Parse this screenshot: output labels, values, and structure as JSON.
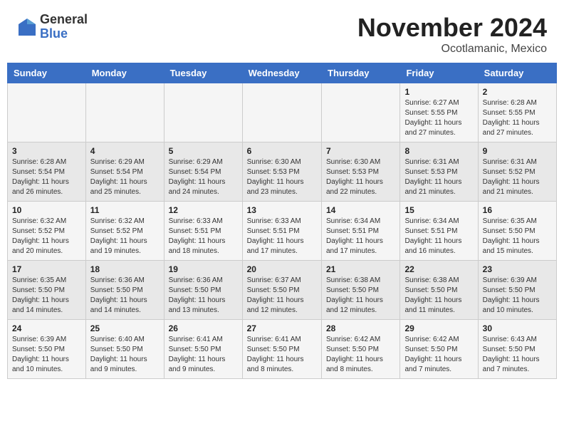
{
  "header": {
    "logo_general": "General",
    "logo_blue": "Blue",
    "month": "November 2024",
    "location": "Ocotlamanic, Mexico"
  },
  "weekdays": [
    "Sunday",
    "Monday",
    "Tuesday",
    "Wednesday",
    "Thursday",
    "Friday",
    "Saturday"
  ],
  "weeks": [
    [
      {
        "day": "",
        "info": ""
      },
      {
        "day": "",
        "info": ""
      },
      {
        "day": "",
        "info": ""
      },
      {
        "day": "",
        "info": ""
      },
      {
        "day": "",
        "info": ""
      },
      {
        "day": "1",
        "info": "Sunrise: 6:27 AM\nSunset: 5:55 PM\nDaylight: 11 hours\nand 27 minutes."
      },
      {
        "day": "2",
        "info": "Sunrise: 6:28 AM\nSunset: 5:55 PM\nDaylight: 11 hours\nand 27 minutes."
      }
    ],
    [
      {
        "day": "3",
        "info": "Sunrise: 6:28 AM\nSunset: 5:54 PM\nDaylight: 11 hours\nand 26 minutes."
      },
      {
        "day": "4",
        "info": "Sunrise: 6:29 AM\nSunset: 5:54 PM\nDaylight: 11 hours\nand 25 minutes."
      },
      {
        "day": "5",
        "info": "Sunrise: 6:29 AM\nSunset: 5:54 PM\nDaylight: 11 hours\nand 24 minutes."
      },
      {
        "day": "6",
        "info": "Sunrise: 6:30 AM\nSunset: 5:53 PM\nDaylight: 11 hours\nand 23 minutes."
      },
      {
        "day": "7",
        "info": "Sunrise: 6:30 AM\nSunset: 5:53 PM\nDaylight: 11 hours\nand 22 minutes."
      },
      {
        "day": "8",
        "info": "Sunrise: 6:31 AM\nSunset: 5:53 PM\nDaylight: 11 hours\nand 21 minutes."
      },
      {
        "day": "9",
        "info": "Sunrise: 6:31 AM\nSunset: 5:52 PM\nDaylight: 11 hours\nand 21 minutes."
      }
    ],
    [
      {
        "day": "10",
        "info": "Sunrise: 6:32 AM\nSunset: 5:52 PM\nDaylight: 11 hours\nand 20 minutes."
      },
      {
        "day": "11",
        "info": "Sunrise: 6:32 AM\nSunset: 5:52 PM\nDaylight: 11 hours\nand 19 minutes."
      },
      {
        "day": "12",
        "info": "Sunrise: 6:33 AM\nSunset: 5:51 PM\nDaylight: 11 hours\nand 18 minutes."
      },
      {
        "day": "13",
        "info": "Sunrise: 6:33 AM\nSunset: 5:51 PM\nDaylight: 11 hours\nand 17 minutes."
      },
      {
        "day": "14",
        "info": "Sunrise: 6:34 AM\nSunset: 5:51 PM\nDaylight: 11 hours\nand 17 minutes."
      },
      {
        "day": "15",
        "info": "Sunrise: 6:34 AM\nSunset: 5:51 PM\nDaylight: 11 hours\nand 16 minutes."
      },
      {
        "day": "16",
        "info": "Sunrise: 6:35 AM\nSunset: 5:50 PM\nDaylight: 11 hours\nand 15 minutes."
      }
    ],
    [
      {
        "day": "17",
        "info": "Sunrise: 6:35 AM\nSunset: 5:50 PM\nDaylight: 11 hours\nand 14 minutes."
      },
      {
        "day": "18",
        "info": "Sunrise: 6:36 AM\nSunset: 5:50 PM\nDaylight: 11 hours\nand 14 minutes."
      },
      {
        "day": "19",
        "info": "Sunrise: 6:36 AM\nSunset: 5:50 PM\nDaylight: 11 hours\nand 13 minutes."
      },
      {
        "day": "20",
        "info": "Sunrise: 6:37 AM\nSunset: 5:50 PM\nDaylight: 11 hours\nand 12 minutes."
      },
      {
        "day": "21",
        "info": "Sunrise: 6:38 AM\nSunset: 5:50 PM\nDaylight: 11 hours\nand 12 minutes."
      },
      {
        "day": "22",
        "info": "Sunrise: 6:38 AM\nSunset: 5:50 PM\nDaylight: 11 hours\nand 11 minutes."
      },
      {
        "day": "23",
        "info": "Sunrise: 6:39 AM\nSunset: 5:50 PM\nDaylight: 11 hours\nand 10 minutes."
      }
    ],
    [
      {
        "day": "24",
        "info": "Sunrise: 6:39 AM\nSunset: 5:50 PM\nDaylight: 11 hours\nand 10 minutes."
      },
      {
        "day": "25",
        "info": "Sunrise: 6:40 AM\nSunset: 5:50 PM\nDaylight: 11 hours\nand 9 minutes."
      },
      {
        "day": "26",
        "info": "Sunrise: 6:41 AM\nSunset: 5:50 PM\nDaylight: 11 hours\nand 9 minutes."
      },
      {
        "day": "27",
        "info": "Sunrise: 6:41 AM\nSunset: 5:50 PM\nDaylight: 11 hours\nand 8 minutes."
      },
      {
        "day": "28",
        "info": "Sunrise: 6:42 AM\nSunset: 5:50 PM\nDaylight: 11 hours\nand 8 minutes."
      },
      {
        "day": "29",
        "info": "Sunrise: 6:42 AM\nSunset: 5:50 PM\nDaylight: 11 hours\nand 7 minutes."
      },
      {
        "day": "30",
        "info": "Sunrise: 6:43 AM\nSunset: 5:50 PM\nDaylight: 11 hours\nand 7 minutes."
      }
    ]
  ]
}
